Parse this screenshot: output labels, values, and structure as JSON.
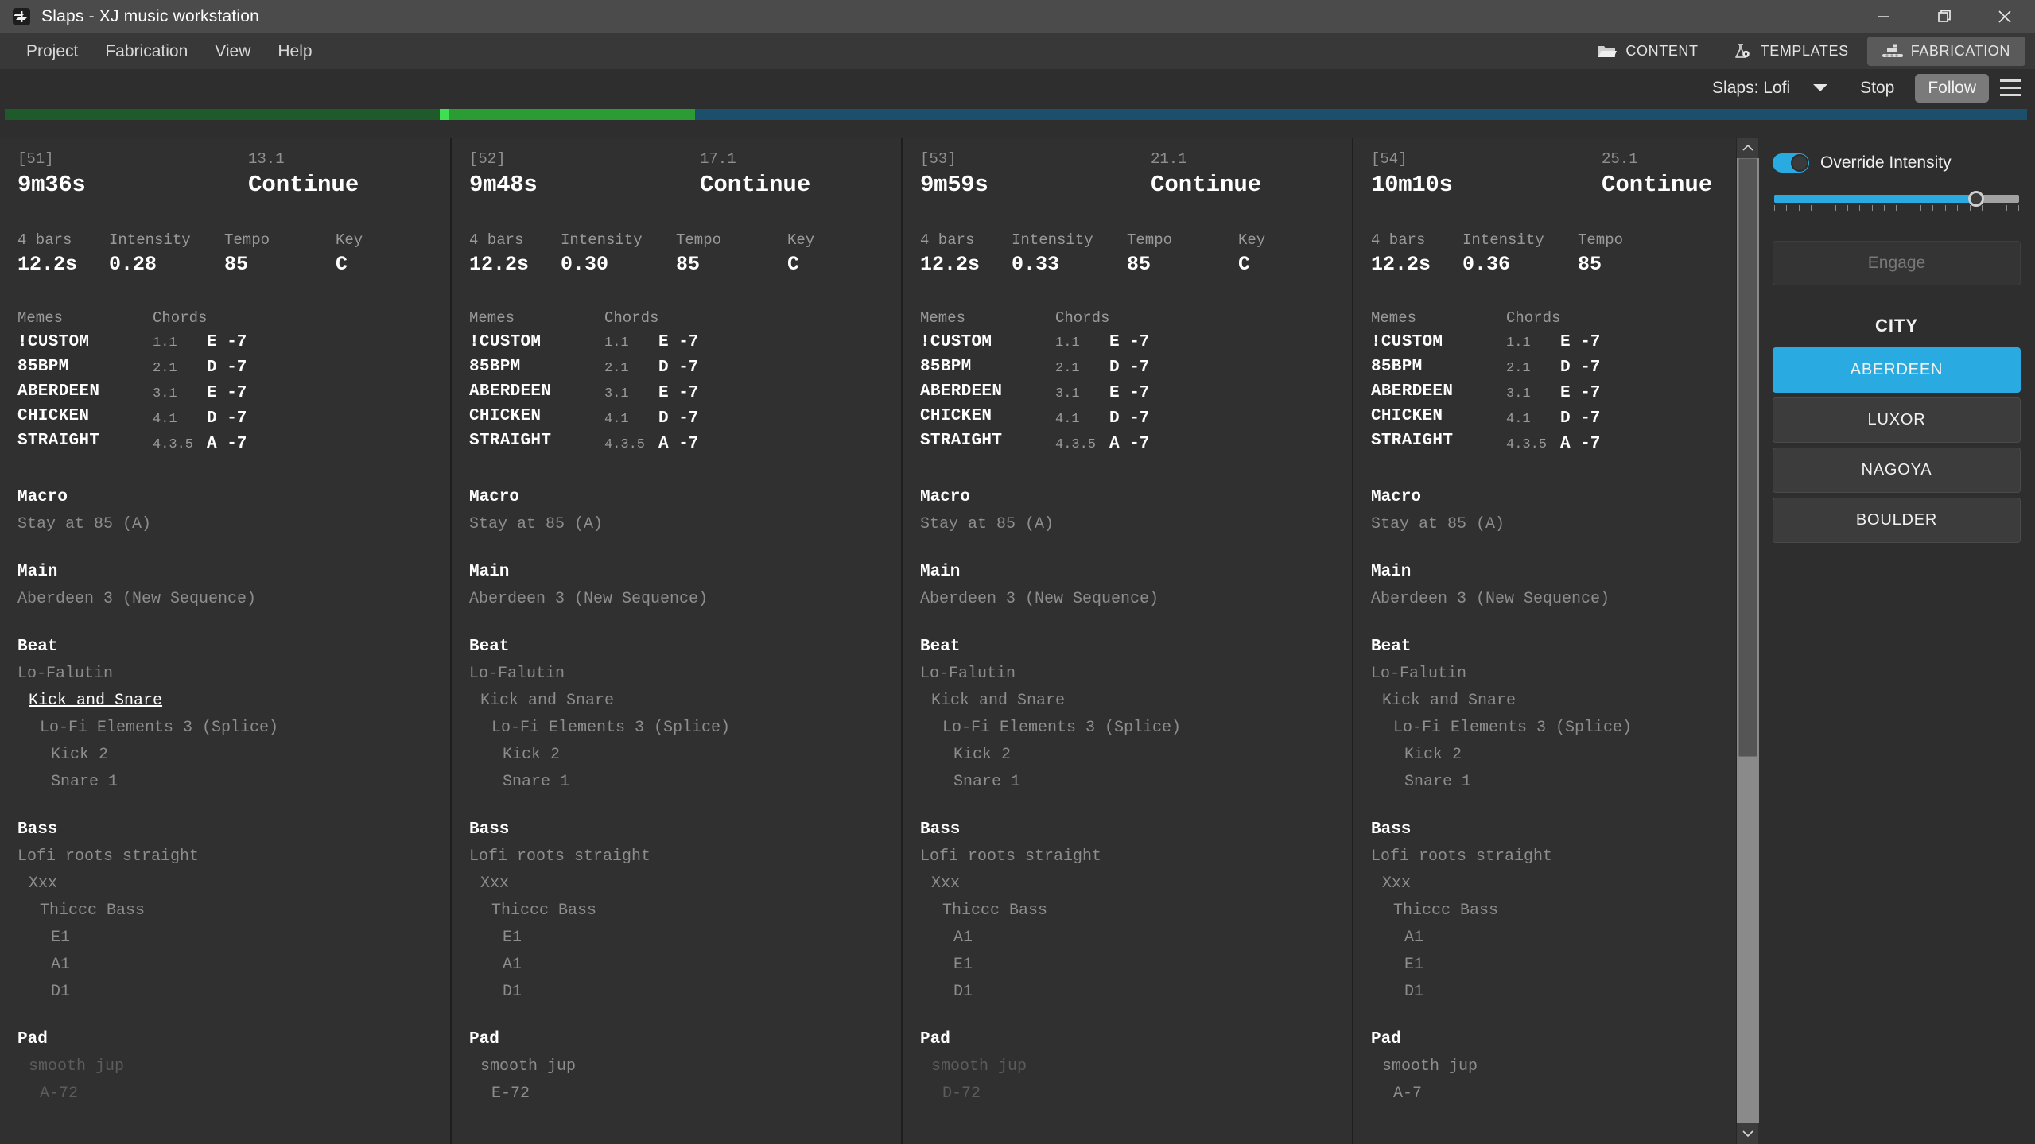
{
  "window": {
    "title": "Slaps - XJ music workstation",
    "icon": "app-logo-icon",
    "minimize": "minimize-icon",
    "maximize": "maximize-icon",
    "close": "close-icon"
  },
  "menubar": {
    "items": [
      "Project",
      "Fabrication",
      "View",
      "Help"
    ]
  },
  "toptabs": [
    {
      "label": "CONTENT",
      "icon": "folder-icon",
      "active": false
    },
    {
      "label": "TEMPLATES",
      "icon": "flask-gear-icon",
      "active": false
    },
    {
      "label": "FABRICATION",
      "icon": "factory-icon",
      "active": true
    }
  ],
  "transport": {
    "project_name": "Slaps: Lofi",
    "dropdown_icon": "chevron-down-icon",
    "stop_label": "Stop",
    "follow_label": "Follow",
    "menu_icon": "hamburger-icon"
  },
  "timeline": {
    "segments": [
      {
        "color": "#1e5a2a",
        "width_pct": 21.5
      },
      {
        "color": "#3ee052",
        "width_pct": 0.45
      },
      {
        "color": "#2b9c34",
        "width_pct": 12.2
      },
      {
        "color": "#1b4f6b",
        "width_pct": 65.85
      }
    ]
  },
  "labels": {
    "memes": "Memes",
    "chords": "Chords",
    "bars_label": "4 bars",
    "intensity_label": "Intensity",
    "tempo_label": "Tempo",
    "key_label": "Key"
  },
  "cards": [
    {
      "id": "[51]",
      "time": "9m36s",
      "position": "13.1",
      "type": "Continue",
      "bars": "4 bars",
      "duration": "12.2s",
      "intensity": "0.28",
      "tempo": "85",
      "key": "C",
      "memes": [
        "!CUSTOM",
        "85BPM",
        "ABERDEEN",
        "CHICKEN",
        "STRAIGHT"
      ],
      "chords": [
        {
          "pos": "1.1",
          "name": "E -7"
        },
        {
          "pos": "2.1",
          "name": "D -7"
        },
        {
          "pos": "3.1",
          "name": "E -7"
        },
        {
          "pos": "4.1",
          "name": "D -7"
        },
        {
          "pos": "4.3.5",
          "name": "A -7"
        }
      ],
      "sections": [
        {
          "title": "Macro",
          "lines": [
            {
              "text": "Stay at 85 (A)",
              "indent": 1,
              "style": "normal"
            }
          ]
        },
        {
          "title": "Main",
          "lines": [
            {
              "text": "Aberdeen 3 (New Sequence)",
              "indent": 1,
              "style": "normal"
            }
          ]
        },
        {
          "title": "Beat",
          "lines": [
            {
              "text": "Lo-Falutin",
              "indent": 1,
              "style": "normal"
            },
            {
              "text": "Kick and Snare",
              "indent": 2,
              "style": "highlight"
            },
            {
              "text": "Lo-Fi Elements 3 (Splice)",
              "indent": 3,
              "style": "normal"
            },
            {
              "text": "Kick 2",
              "indent": 4,
              "style": "normal"
            },
            {
              "text": "Snare 1",
              "indent": 4,
              "style": "normal"
            }
          ]
        },
        {
          "title": "Bass",
          "lines": [
            {
              "text": "Lofi roots straight",
              "indent": 1,
              "style": "normal"
            },
            {
              "text": "Xxx",
              "indent": 2,
              "style": "normal"
            },
            {
              "text": "Thiccc Bass",
              "indent": 3,
              "style": "normal"
            },
            {
              "text": "E1",
              "indent": 4,
              "style": "normal"
            },
            {
              "text": "A1",
              "indent": 4,
              "style": "normal"
            },
            {
              "text": "D1",
              "indent": 4,
              "style": "normal"
            }
          ]
        },
        {
          "title": "Pad",
          "lines": [
            {
              "text": "smooth jup",
              "indent": 2,
              "style": "dim"
            },
            {
              "text": "A-72",
              "indent": 3,
              "style": "dim"
            }
          ]
        }
      ]
    },
    {
      "id": "[52]",
      "time": "9m48s",
      "position": "17.1",
      "type": "Continue",
      "bars": "4 bars",
      "duration": "12.2s",
      "intensity": "0.30",
      "tempo": "85",
      "key": "C",
      "memes": [
        "!CUSTOM",
        "85BPM",
        "ABERDEEN",
        "CHICKEN",
        "STRAIGHT"
      ],
      "chords": [
        {
          "pos": "1.1",
          "name": "E -7"
        },
        {
          "pos": "2.1",
          "name": "D -7"
        },
        {
          "pos": "3.1",
          "name": "E -7"
        },
        {
          "pos": "4.1",
          "name": "D -7"
        },
        {
          "pos": "4.3.5",
          "name": "A -7"
        }
      ],
      "sections": [
        {
          "title": "Macro",
          "lines": [
            {
              "text": "Stay at 85 (A)",
              "indent": 1,
              "style": "normal"
            }
          ]
        },
        {
          "title": "Main",
          "lines": [
            {
              "text": "Aberdeen 3 (New Sequence)",
              "indent": 1,
              "style": "normal"
            }
          ]
        },
        {
          "title": "Beat",
          "lines": [
            {
              "text": "Lo-Falutin",
              "indent": 1,
              "style": "normal"
            },
            {
              "text": "Kick and Snare",
              "indent": 2,
              "style": "normal"
            },
            {
              "text": "Lo-Fi Elements 3 (Splice)",
              "indent": 3,
              "style": "normal"
            },
            {
              "text": "Kick 2",
              "indent": 4,
              "style": "normal"
            },
            {
              "text": "Snare 1",
              "indent": 4,
              "style": "normal"
            }
          ]
        },
        {
          "title": "Bass",
          "lines": [
            {
              "text": "Lofi roots straight",
              "indent": 1,
              "style": "normal"
            },
            {
              "text": "Xxx",
              "indent": 2,
              "style": "normal"
            },
            {
              "text": "Thiccc Bass",
              "indent": 3,
              "style": "normal"
            },
            {
              "text": "E1",
              "indent": 4,
              "style": "normal"
            },
            {
              "text": "A1",
              "indent": 4,
              "style": "normal"
            },
            {
              "text": "D1",
              "indent": 4,
              "style": "normal"
            }
          ]
        },
        {
          "title": "Pad",
          "lines": [
            {
              "text": "smooth jup",
              "indent": 2,
              "style": "normal"
            },
            {
              "text": "E-72",
              "indent": 3,
              "style": "normal"
            }
          ]
        }
      ]
    },
    {
      "id": "[53]",
      "time": "9m59s",
      "position": "21.1",
      "type": "Continue",
      "bars": "4 bars",
      "duration": "12.2s",
      "intensity": "0.33",
      "tempo": "85",
      "key": "C",
      "memes": [
        "!CUSTOM",
        "85BPM",
        "ABERDEEN",
        "CHICKEN",
        "STRAIGHT"
      ],
      "chords": [
        {
          "pos": "1.1",
          "name": "E -7"
        },
        {
          "pos": "2.1",
          "name": "D -7"
        },
        {
          "pos": "3.1",
          "name": "E -7"
        },
        {
          "pos": "4.1",
          "name": "D -7"
        },
        {
          "pos": "4.3.5",
          "name": "A -7"
        }
      ],
      "sections": [
        {
          "title": "Macro",
          "lines": [
            {
              "text": "Stay at 85 (A)",
              "indent": 1,
              "style": "normal"
            }
          ]
        },
        {
          "title": "Main",
          "lines": [
            {
              "text": "Aberdeen 3 (New Sequence)",
              "indent": 1,
              "style": "normal"
            }
          ]
        },
        {
          "title": "Beat",
          "lines": [
            {
              "text": "Lo-Falutin",
              "indent": 1,
              "style": "normal"
            },
            {
              "text": "Kick and Snare",
              "indent": 2,
              "style": "normal"
            },
            {
              "text": "Lo-Fi Elements 3 (Splice)",
              "indent": 3,
              "style": "normal"
            },
            {
              "text": "Kick 2",
              "indent": 4,
              "style": "normal"
            },
            {
              "text": "Snare 1",
              "indent": 4,
              "style": "normal"
            }
          ]
        },
        {
          "title": "Bass",
          "lines": [
            {
              "text": "Lofi roots straight",
              "indent": 1,
              "style": "normal"
            },
            {
              "text": "Xxx",
              "indent": 2,
              "style": "normal"
            },
            {
              "text": "Thiccc Bass",
              "indent": 3,
              "style": "normal"
            },
            {
              "text": "A1",
              "indent": 4,
              "style": "normal"
            },
            {
              "text": "E1",
              "indent": 4,
              "style": "normal"
            },
            {
              "text": "D1",
              "indent": 4,
              "style": "normal"
            }
          ]
        },
        {
          "title": "Pad",
          "lines": [
            {
              "text": "smooth jup",
              "indent": 2,
              "style": "dim"
            },
            {
              "text": "D-72",
              "indent": 3,
              "style": "dim"
            }
          ]
        }
      ]
    },
    {
      "id": "[54]",
      "time": "10m10s",
      "position": "25.1",
      "type": "Continue",
      "bars": "4 bars",
      "duration": "12.2s",
      "intensity": "0.36",
      "tempo": "85",
      "key": "",
      "memes": [
        "!CUSTOM",
        "85BPM",
        "ABERDEEN",
        "CHICKEN",
        "STRAIGHT"
      ],
      "chords": [
        {
          "pos": "1.1",
          "name": "E -7"
        },
        {
          "pos": "2.1",
          "name": "D -7"
        },
        {
          "pos": "3.1",
          "name": "E -7"
        },
        {
          "pos": "4.1",
          "name": "D -7"
        },
        {
          "pos": "4.3.5",
          "name": "A -7"
        }
      ],
      "sections": [
        {
          "title": "Macro",
          "lines": [
            {
              "text": "Stay at 85 (A)",
              "indent": 1,
              "style": "normal"
            }
          ]
        },
        {
          "title": "Main",
          "lines": [
            {
              "text": "Aberdeen 3 (New Sequence)",
              "indent": 1,
              "style": "normal"
            }
          ]
        },
        {
          "title": "Beat",
          "lines": [
            {
              "text": "Lo-Falutin",
              "indent": 1,
              "style": "normal"
            },
            {
              "text": "Kick and Snare",
              "indent": 2,
              "style": "normal"
            },
            {
              "text": "Lo-Fi Elements 3 (Splice)",
              "indent": 3,
              "style": "normal"
            },
            {
              "text": "Kick 2",
              "indent": 4,
              "style": "normal"
            },
            {
              "text": "Snare 1",
              "indent": 4,
              "style": "normal"
            }
          ]
        },
        {
          "title": "Bass",
          "lines": [
            {
              "text": "Lofi roots straight",
              "indent": 1,
              "style": "normal"
            },
            {
              "text": "Xxx",
              "indent": 2,
              "style": "normal"
            },
            {
              "text": "Thiccc Bass",
              "indent": 3,
              "style": "normal"
            },
            {
              "text": "A1",
              "indent": 4,
              "style": "normal"
            },
            {
              "text": "E1",
              "indent": 4,
              "style": "normal"
            },
            {
              "text": "D1",
              "indent": 4,
              "style": "normal"
            }
          ]
        },
        {
          "title": "Pad",
          "lines": [
            {
              "text": "smooth jup",
              "indent": 2,
              "style": "normal"
            },
            {
              "text": "A-7",
              "indent": 3,
              "style": "normal"
            }
          ]
        }
      ]
    }
  ],
  "rightpanel": {
    "override_label": "Override Intensity",
    "override_enabled": true,
    "slider_pct": 82,
    "engage_label": "Engage",
    "engage_enabled": false,
    "city_title": "CITY",
    "cities": [
      {
        "label": "ABERDEEN",
        "selected": true
      },
      {
        "label": "LUXOR",
        "selected": false
      },
      {
        "label": "NAGOYA",
        "selected": false
      },
      {
        "label": "BOULDER",
        "selected": false
      }
    ],
    "accent_color": "#29abe2"
  },
  "scrollbar": {
    "up_icon": "chevron-up-icon",
    "down_icon": "chevron-down-icon",
    "thumb_pct": 62
  }
}
